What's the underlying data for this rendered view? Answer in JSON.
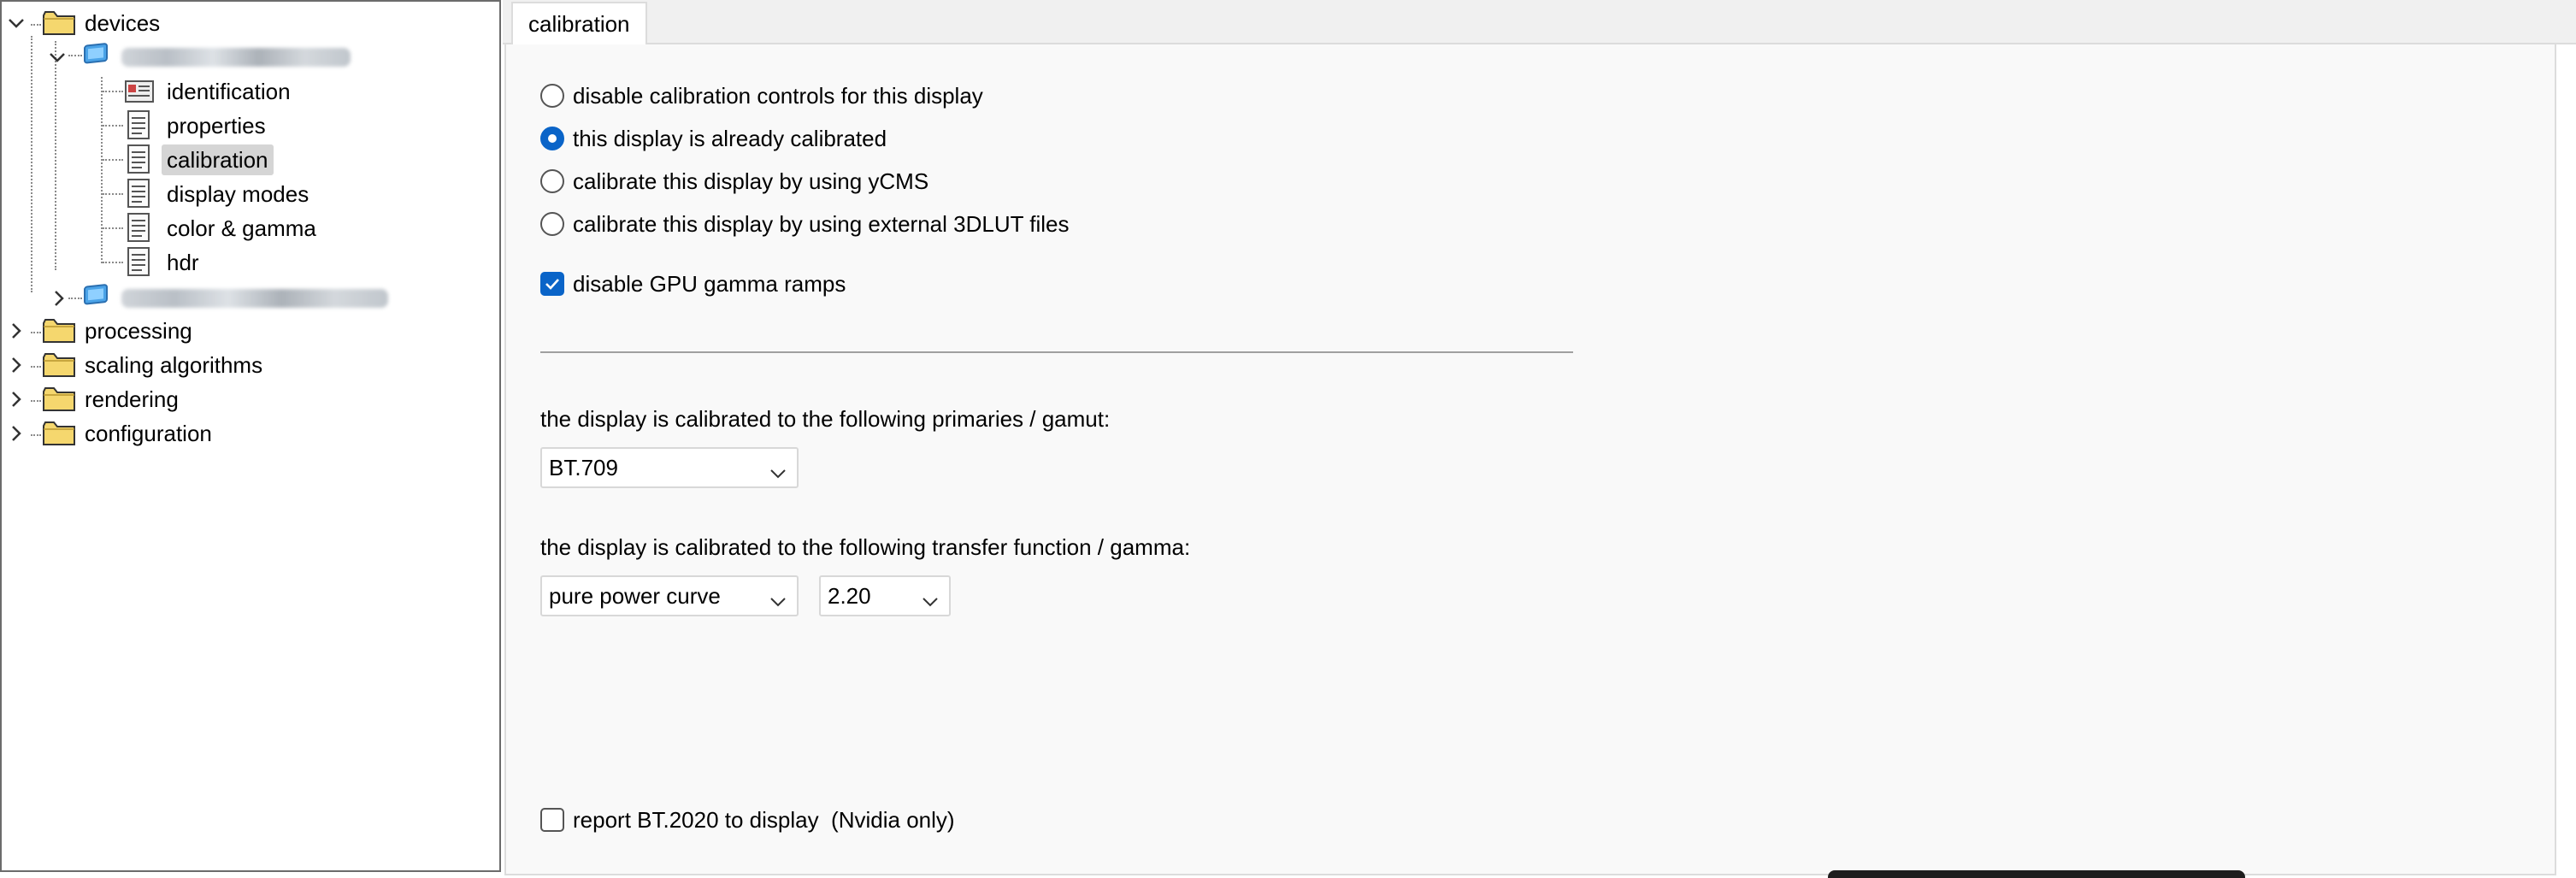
{
  "tree": {
    "root": {
      "label": "devices",
      "icon": "folder-icon"
    },
    "device1": {
      "label": "",
      "icon": "monitor-icon"
    },
    "children": [
      {
        "label": "identification",
        "icon": "id-card-icon"
      },
      {
        "label": "properties",
        "icon": "document-icon"
      },
      {
        "label": "calibration",
        "icon": "document-icon",
        "selected": true
      },
      {
        "label": "display modes",
        "icon": "document-icon"
      },
      {
        "label": "color & gamma",
        "icon": "document-icon"
      },
      {
        "label": "hdr",
        "icon": "document-icon"
      }
    ],
    "device2": {
      "label": "",
      "icon": "monitor-icon"
    },
    "top_items": [
      {
        "label": "processing",
        "icon": "folder-icon"
      },
      {
        "label": "scaling algorithms",
        "icon": "folder-icon"
      },
      {
        "label": "rendering",
        "icon": "folder-icon"
      },
      {
        "label": "configuration",
        "icon": "folder-icon"
      }
    ]
  },
  "tab": {
    "label": "calibration"
  },
  "options": {
    "radios": [
      {
        "label": "disable calibration controls for this display",
        "checked": false
      },
      {
        "label": "this display is already calibrated",
        "checked": true
      },
      {
        "label": "calibrate this display by using yCMS",
        "checked": false
      },
      {
        "label": "calibrate this display by using external 3DLUT files",
        "checked": false
      }
    ],
    "gpu_gamma": {
      "label": "disable GPU gamma ramps",
      "checked": true
    }
  },
  "primaries": {
    "heading": "the display is calibrated to the following primaries / gamut:",
    "value": "BT.709"
  },
  "transfer": {
    "heading": "the display is calibrated to the following transfer function / gamma:",
    "curve_value": "pure power curve",
    "gamma_value": "2.20"
  },
  "report": {
    "label": "report BT.2020 to display  (Nvidia only)",
    "checked": false
  },
  "colors": {
    "accent": "#0a64c8",
    "selected_bg": "#d5d5d5",
    "folder": "#f5d76e",
    "panel_bg": "#f9f9f9"
  }
}
